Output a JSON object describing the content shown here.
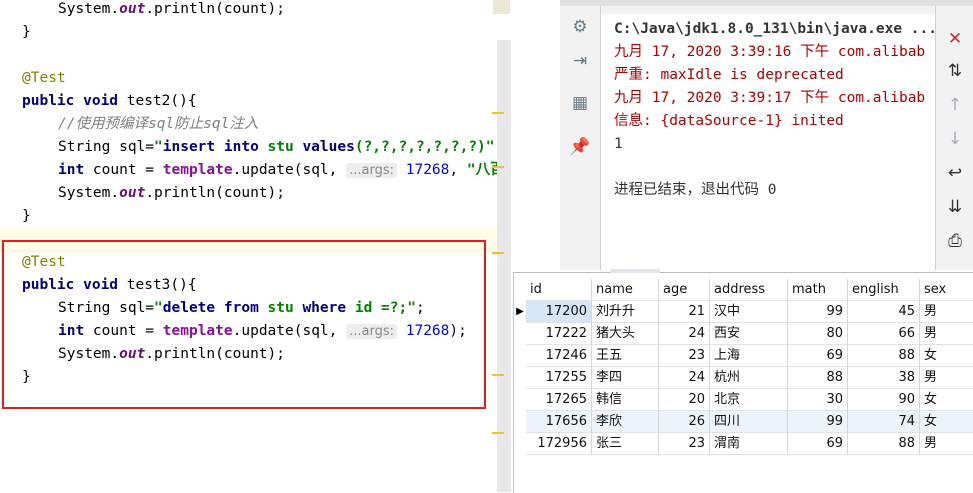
{
  "editor": {
    "lines": {
      "l1_a": "System.",
      "l1_b": "out",
      "l1_c": ".println(count);",
      "l2": "}",
      "l3": "@Test",
      "l4_kw": "public void",
      "l4_rest": " test2(){",
      "l5": "//使用预编译sql防止sql注入",
      "l6_a": "String sql=",
      "l6_q1": "\"",
      "l6_s1": "insert into",
      "l6_s2": " stu ",
      "l6_s3": "values",
      "l6_s4": "(?,?,?,?,?,?,?)",
      "l6_q2": "\"",
      "l7_kw": "int",
      "l7_a": " count = ",
      "l7_fn": "template",
      "l7_b": ".update(sql, ",
      "l7_hint": "...args:",
      "l7_num": " 17268",
      "l7_c": ", ",
      "l7_str": "\"八百",
      "l8_a": "System.",
      "l8_b": "out",
      "l8_c": ".println(count);",
      "l9": "}",
      "l10": "@Test",
      "l11_kw": "public void",
      "l11_rest": " test3(){",
      "l12_a": "String sql=",
      "l12_q1": "\"",
      "l12_s1": "delete from",
      "l12_s2": " stu ",
      "l12_s3": "where",
      "l12_s4": " id =?;",
      "l12_q2": "\"",
      "l12_end": ";",
      "l13_kw": "int",
      "l13_a": " count = ",
      "l13_fn": "template",
      "l13_b": ".update(sql, ",
      "l13_hint": "...args:",
      "l13_num": " 17268",
      "l13_c": ");",
      "l14_a": "System.",
      "l14_b": "out",
      "l14_c": ".println(count);",
      "l15": "}"
    }
  },
  "console": {
    "path": "C:\\Java\\jdk1.8.0_131\\bin\\java.exe ...",
    "log1": "九月 17, 2020 3:39:16 下午 com.alibab",
    "log2": "严重: maxIdle is deprecated",
    "log3": "九月 17, 2020 3:39:17 下午 com.alibab",
    "log4": "信息: {dataSource-1} inited",
    "result": "1",
    "exit": "进程已结束，退出代码 0"
  },
  "run_toolbar": {
    "left_icons": [
      "bug-icon",
      "login-icon",
      "layout-icon",
      "pin-icon"
    ],
    "right_icons": [
      "clear-icon",
      "sort-icon",
      "up-icon",
      "down-icon",
      "wrap-icon",
      "scroll-end-icon",
      "print-icon"
    ],
    "glyphs": {
      "bug": "⚙",
      "login": "⇥",
      "layout": "▦",
      "pin": "📌",
      "clear": "✕",
      "sort": "⇅",
      "up": "↑",
      "down": "↓",
      "wrap": "↩",
      "scroll": "⇊",
      "print": "⎙"
    }
  },
  "table": {
    "columns": [
      "id",
      "name",
      "age",
      "address",
      "math",
      "english",
      "sex"
    ],
    "rows": [
      [
        "17200",
        "刘升升",
        "21",
        "汉中",
        "99",
        "45",
        "男"
      ],
      [
        "17222",
        "猪大头",
        "24",
        "西安",
        "80",
        "66",
        "男"
      ],
      [
        "17246",
        "王五",
        "23",
        "上海",
        "69",
        "88",
        "女"
      ],
      [
        "17255",
        "李四",
        "24",
        "杭州",
        "88",
        "38",
        "男"
      ],
      [
        "17265",
        "韩信",
        "20",
        "北京",
        "30",
        "90",
        "女"
      ],
      [
        "17656",
        "李欣",
        "26",
        "四川",
        "99",
        "74",
        "女"
      ],
      [
        "172956",
        "张三",
        "23",
        "渭南",
        "69",
        "88",
        "男"
      ]
    ]
  }
}
